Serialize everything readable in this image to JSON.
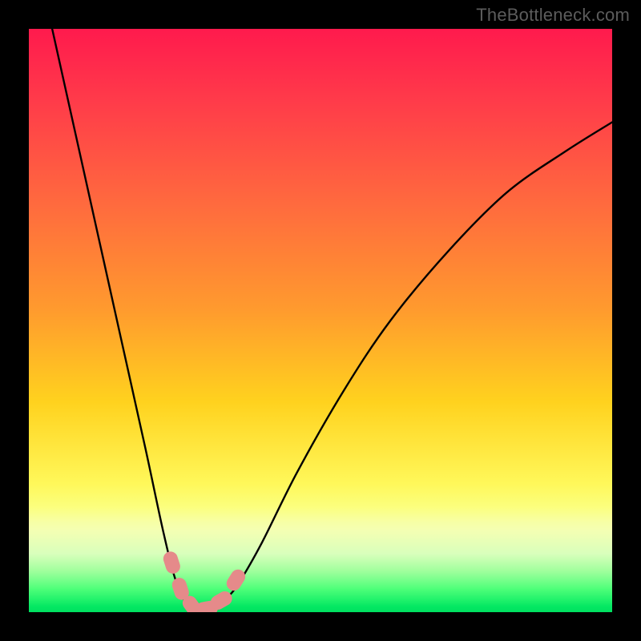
{
  "attribution": "TheBottleneck.com",
  "chart_data": {
    "type": "line",
    "title": "",
    "xlabel": "",
    "ylabel": "",
    "xlim": [
      0,
      100
    ],
    "ylim": [
      0,
      100
    ],
    "series": [
      {
        "name": "bottleneck-curve",
        "x": [
          4,
          8,
          12,
          16,
          20,
          23,
          25,
          27,
          29,
          30.5,
          32,
          34,
          36,
          40,
          46,
          54,
          62,
          72,
          82,
          92,
          100
        ],
        "y": [
          100,
          82,
          64,
          46,
          28,
          14,
          6,
          1.5,
          0.5,
          0.5,
          1,
          2.5,
          5,
          12,
          24,
          38,
          50,
          62,
          72,
          79,
          84
        ]
      }
    ],
    "markers": [
      {
        "name": "highlight-1",
        "x": 24.5,
        "y": 8.5,
        "color": "#e58a8a"
      },
      {
        "name": "highlight-2",
        "x": 26.0,
        "y": 4.0,
        "color": "#e58a8a"
      },
      {
        "name": "highlight-3",
        "x": 28.0,
        "y": 1.0,
        "color": "#e58a8a"
      },
      {
        "name": "highlight-4",
        "x": 30.5,
        "y": 0.6,
        "color": "#e58a8a"
      },
      {
        "name": "highlight-5",
        "x": 33.0,
        "y": 2.0,
        "color": "#e58a8a"
      },
      {
        "name": "highlight-6",
        "x": 35.5,
        "y": 5.5,
        "color": "#e58a8a"
      }
    ],
    "background": {
      "type": "vertical-gradient",
      "stops": [
        {
          "pos": 0,
          "color": "#ff1a4d"
        },
        {
          "pos": 50,
          "color": "#ffb020"
        },
        {
          "pos": 80,
          "color": "#fff85a"
        },
        {
          "pos": 100,
          "color": "#00e060"
        }
      ]
    }
  }
}
